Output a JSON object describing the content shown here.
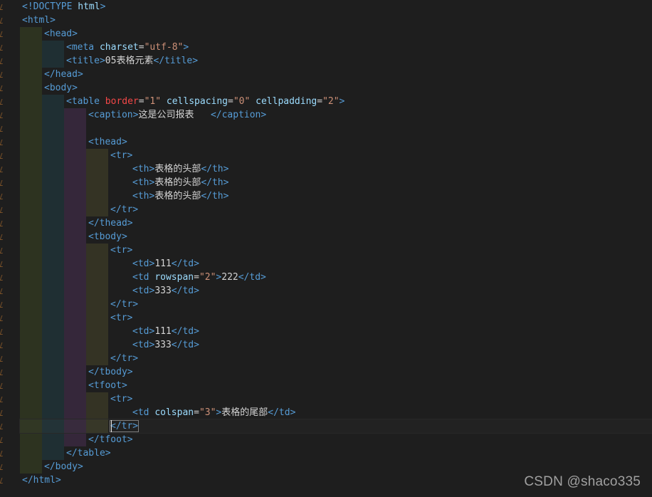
{
  "editor": {
    "colors": {
      "background": "#1e1e1e",
      "tag": "#569cd6",
      "attribute": "#9cdcfe",
      "string": "#ce9178",
      "text": "#d4d4d4",
      "attribute_highlight": "#f44747",
      "indent_guide_1": "#2d3320",
      "indent_guide_2": "#1f2f33",
      "indent_guide_3": "#35273a",
      "indent_guide_4": "#343324"
    },
    "lines": [
      {
        "indent": 0,
        "segs": [
          {
            "t": "<!DOCTYPE ",
            "c": "tag"
          },
          {
            "t": "html",
            "c": "attr"
          },
          {
            "t": ">",
            "c": "tag"
          }
        ]
      },
      {
        "indent": 0,
        "segs": [
          {
            "t": "<html>",
            "c": "tag"
          }
        ]
      },
      {
        "indent": 1,
        "segs": [
          {
            "t": "<head>",
            "c": "tag"
          }
        ]
      },
      {
        "indent": 2,
        "segs": [
          {
            "t": "<meta ",
            "c": "tag"
          },
          {
            "t": "charset",
            "c": "attr"
          },
          {
            "t": "=",
            "c": "txt"
          },
          {
            "t": "\"utf-8\"",
            "c": "str"
          },
          {
            "t": ">",
            "c": "tag"
          }
        ]
      },
      {
        "indent": 2,
        "segs": [
          {
            "t": "<title>",
            "c": "tag"
          },
          {
            "t": "05表格元素",
            "c": "txt"
          },
          {
            "t": "</title>",
            "c": "tag"
          }
        ]
      },
      {
        "indent": 1,
        "segs": [
          {
            "t": "</head>",
            "c": "tag"
          }
        ]
      },
      {
        "indent": 1,
        "segs": [
          {
            "t": "<body>",
            "c": "tag"
          }
        ]
      },
      {
        "indent": 2,
        "segs": [
          {
            "t": "<table ",
            "c": "tag"
          },
          {
            "t": "border",
            "c": "attr-red"
          },
          {
            "t": "=",
            "c": "txt"
          },
          {
            "t": "\"1\"",
            "c": "str"
          },
          {
            "t": " ",
            "c": "txt"
          },
          {
            "t": "cellspacing",
            "c": "attr"
          },
          {
            "t": "=",
            "c": "txt"
          },
          {
            "t": "\"0\"",
            "c": "str"
          },
          {
            "t": " ",
            "c": "txt"
          },
          {
            "t": "cellpadding",
            "c": "attr"
          },
          {
            "t": "=",
            "c": "txt"
          },
          {
            "t": "\"2\"",
            "c": "str"
          },
          {
            "t": ">",
            "c": "tag"
          }
        ]
      },
      {
        "indent": 3,
        "segs": [
          {
            "t": "<caption>",
            "c": "tag"
          },
          {
            "t": "这是公司报表   ",
            "c": "txt"
          },
          {
            "t": "</caption>",
            "c": "tag"
          }
        ]
      },
      {
        "indent": 3,
        "segs": []
      },
      {
        "indent": 3,
        "segs": [
          {
            "t": "<thead>",
            "c": "tag"
          }
        ]
      },
      {
        "indent": 4,
        "segs": [
          {
            "t": "<tr>",
            "c": "tag"
          }
        ]
      },
      {
        "indent": 5,
        "segs": [
          {
            "t": "<th>",
            "c": "tag"
          },
          {
            "t": "表格的头部",
            "c": "txt"
          },
          {
            "t": "</th>",
            "c": "tag"
          }
        ]
      },
      {
        "indent": 5,
        "segs": [
          {
            "t": "<th>",
            "c": "tag"
          },
          {
            "t": "表格的头部",
            "c": "txt"
          },
          {
            "t": "</th>",
            "c": "tag"
          }
        ]
      },
      {
        "indent": 5,
        "segs": [
          {
            "t": "<th>",
            "c": "tag"
          },
          {
            "t": "表格的头部",
            "c": "txt"
          },
          {
            "t": "</th>",
            "c": "tag"
          }
        ]
      },
      {
        "indent": 4,
        "segs": [
          {
            "t": "</tr>",
            "c": "tag"
          }
        ]
      },
      {
        "indent": 3,
        "segs": [
          {
            "t": "</thead>",
            "c": "tag"
          }
        ]
      },
      {
        "indent": 3,
        "segs": [
          {
            "t": "<tbody>",
            "c": "tag"
          }
        ]
      },
      {
        "indent": 4,
        "segs": [
          {
            "t": "<tr>",
            "c": "tag"
          }
        ]
      },
      {
        "indent": 5,
        "segs": [
          {
            "t": "<td>",
            "c": "tag"
          },
          {
            "t": "111",
            "c": "txt"
          },
          {
            "t": "</td>",
            "c": "tag"
          }
        ]
      },
      {
        "indent": 5,
        "segs": [
          {
            "t": "<td ",
            "c": "tag"
          },
          {
            "t": "rowspan",
            "c": "attr"
          },
          {
            "t": "=",
            "c": "txt"
          },
          {
            "t": "\"2\"",
            "c": "str"
          },
          {
            "t": ">",
            "c": "tag"
          },
          {
            "t": "222",
            "c": "txt"
          },
          {
            "t": "</td>",
            "c": "tag"
          }
        ]
      },
      {
        "indent": 5,
        "segs": [
          {
            "t": "<td>",
            "c": "tag"
          },
          {
            "t": "333",
            "c": "txt"
          },
          {
            "t": "</td>",
            "c": "tag"
          }
        ]
      },
      {
        "indent": 4,
        "segs": [
          {
            "t": "</tr>",
            "c": "tag"
          }
        ]
      },
      {
        "indent": 4,
        "segs": [
          {
            "t": "<tr>",
            "c": "tag"
          }
        ]
      },
      {
        "indent": 5,
        "segs": [
          {
            "t": "<td>",
            "c": "tag"
          },
          {
            "t": "111",
            "c": "txt"
          },
          {
            "t": "</td>",
            "c": "tag"
          }
        ]
      },
      {
        "indent": 5,
        "segs": [
          {
            "t": "<td>",
            "c": "tag"
          },
          {
            "t": "333",
            "c": "txt"
          },
          {
            "t": "</td>",
            "c": "tag"
          }
        ]
      },
      {
        "indent": 4,
        "segs": [
          {
            "t": "</tr>",
            "c": "tag"
          }
        ]
      },
      {
        "indent": 3,
        "segs": [
          {
            "t": "</tbody>",
            "c": "tag"
          }
        ]
      },
      {
        "indent": 3,
        "segs": [
          {
            "t": "<tfoot>",
            "c": "tag"
          }
        ]
      },
      {
        "indent": 4,
        "segs": [
          {
            "t": "<tr>",
            "c": "tag"
          }
        ]
      },
      {
        "indent": 5,
        "segs": [
          {
            "t": "<td ",
            "c": "tag"
          },
          {
            "t": "colspan",
            "c": "attr"
          },
          {
            "t": "=",
            "c": "txt"
          },
          {
            "t": "\"3\"",
            "c": "str"
          },
          {
            "t": ">",
            "c": "tag"
          },
          {
            "t": "表格的尾部",
            "c": "txt"
          },
          {
            "t": "</td>",
            "c": "tag"
          }
        ]
      },
      {
        "indent": 4,
        "current": true,
        "segs": [
          {
            "t": "</tr>",
            "c": "tag",
            "boxed": true
          }
        ]
      },
      {
        "indent": 3,
        "segs": [
          {
            "t": "</tfoot>",
            "c": "tag"
          }
        ]
      },
      {
        "indent": 2,
        "segs": [
          {
            "t": "</table>",
            "c": "tag"
          }
        ]
      },
      {
        "indent": 1,
        "segs": [
          {
            "t": "</body>",
            "c": "tag"
          }
        ]
      },
      {
        "indent": 0,
        "segs": [
          {
            "t": "</html>",
            "c": "tag"
          }
        ]
      }
    ]
  },
  "watermark": {
    "text": "CSDN @shaco335"
  }
}
